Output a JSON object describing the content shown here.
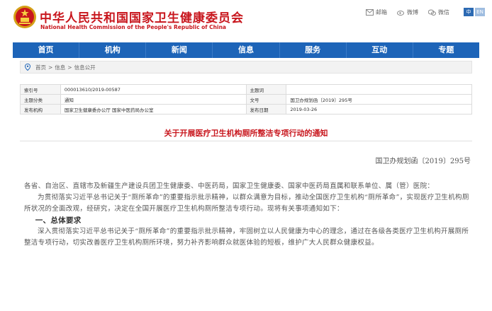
{
  "header": {
    "title": "中华人民共和国国家卫生健康委员会",
    "subtitle": "National Health Commission of the People's Republic of China",
    "shortcuts": [
      {
        "label": "邮箱",
        "icon": "mail-icon"
      },
      {
        "label": "微博",
        "icon": "weibo-icon"
      },
      {
        "label": "微信",
        "icon": "wechat-icon"
      }
    ],
    "lang": [
      "中",
      "EN"
    ]
  },
  "nav": {
    "items": [
      "首页",
      "机构",
      "新闻",
      "信息",
      "服务",
      "互动",
      "专题"
    ]
  },
  "breadcrumb": {
    "items": [
      "首页",
      "信息",
      "信息公开"
    ],
    "separator": ">"
  },
  "meta": {
    "rows": [
      {
        "k1": "索引号",
        "v1": "000013610/2019-00587",
        "k2": "主题词",
        "v2": ""
      },
      {
        "k1": "主题分类",
        "v1": "通知",
        "k2": "文号",
        "v2": "国卫办规划函〔2019〕295号"
      },
      {
        "k1": "发布机构",
        "v1": "国家卫生健康委办公厅 国家中医药局办公室",
        "k2": "发布日期",
        "v2": "2019-03-26"
      }
    ]
  },
  "article": {
    "title": "关于开展医疗卫生机构厕所整洁专项行动的通知",
    "doc_number": "国卫办规划函〔2019〕295号",
    "addressee": "各省、自治区、直辖市及新疆生产建设兵团卫生健康委、中医药局，国家卫生健康委、国家中医药局直属和联系单位、属（管）医院：",
    "intro": "为贯彻落实习近平总书记关于“厕所革命”的重要指示批示精神，以群众满意为目标，推动全国医疗卫生机构“厕所革命”，实现医疗卫生机构厕所状况的全面改观，经研究，决定在全国开展医疗卫生机构厕所整洁专项行动。现将有关事项通知如下：",
    "section1_heading": "一、总体要求",
    "section1_text": "深入贯彻落实习近平总书记关于“厕所革命”的重要指示批示精神，牢固树立以人民健康为中心的理念，通过在各级各类医疗卫生机构开展厕所整洁专项行动，切实改善医疗卫生机构厕所环境，努力补齐影响群众就医体验的短板，维护广大人民群众健康权益。"
  },
  "colors": {
    "brand_red": "#c8161d",
    "nav_blue": "#1d64b8"
  }
}
